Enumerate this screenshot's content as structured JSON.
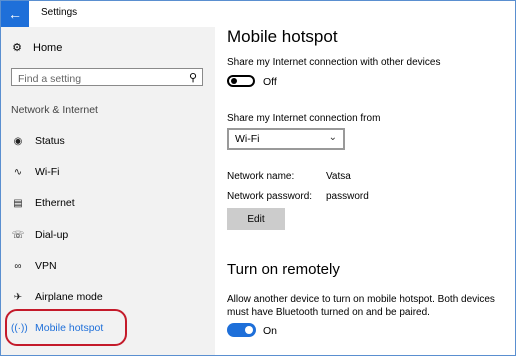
{
  "app": {
    "title": "Settings",
    "back_icon": "back-arrow-icon"
  },
  "sidebar": {
    "home_label": "Home",
    "search_placeholder": "Find a setting",
    "section_title": "Network & Internet",
    "items": [
      {
        "label": "Status",
        "icon": "globe-icon",
        "active": false
      },
      {
        "label": "Wi-Fi",
        "icon": "wifi-icon",
        "active": false
      },
      {
        "label": "Ethernet",
        "icon": "ethernet-icon",
        "active": false
      },
      {
        "label": "Dial-up",
        "icon": "phone-icon",
        "active": false
      },
      {
        "label": "VPN",
        "icon": "vpn-icon",
        "active": false
      },
      {
        "label": "Airplane mode",
        "icon": "airplane-icon",
        "active": false
      },
      {
        "label": "Mobile hotspot",
        "icon": "hotspot-icon",
        "active": true
      }
    ]
  },
  "main": {
    "title": "Mobile hotspot",
    "share_label": "Share my Internet connection with other devices",
    "share_state": "Off",
    "share_from_label": "Share my Internet connection from",
    "share_from_value": "Wi-Fi",
    "network_name_label": "Network name:",
    "network_name_value": "Vatsa",
    "network_password_label": "Network password:",
    "network_password_value": "password",
    "edit_label": "Edit",
    "remote_title": "Turn on remotely",
    "remote_desc": "Allow another device to turn on mobile hotspot. Both devices must have Bluetooth turned on and be paired.",
    "remote_state": "On"
  },
  "colors": {
    "accent": "#1e6fd9",
    "highlight": "#c41a2a",
    "sidebar_bg": "#f2f2f2"
  }
}
